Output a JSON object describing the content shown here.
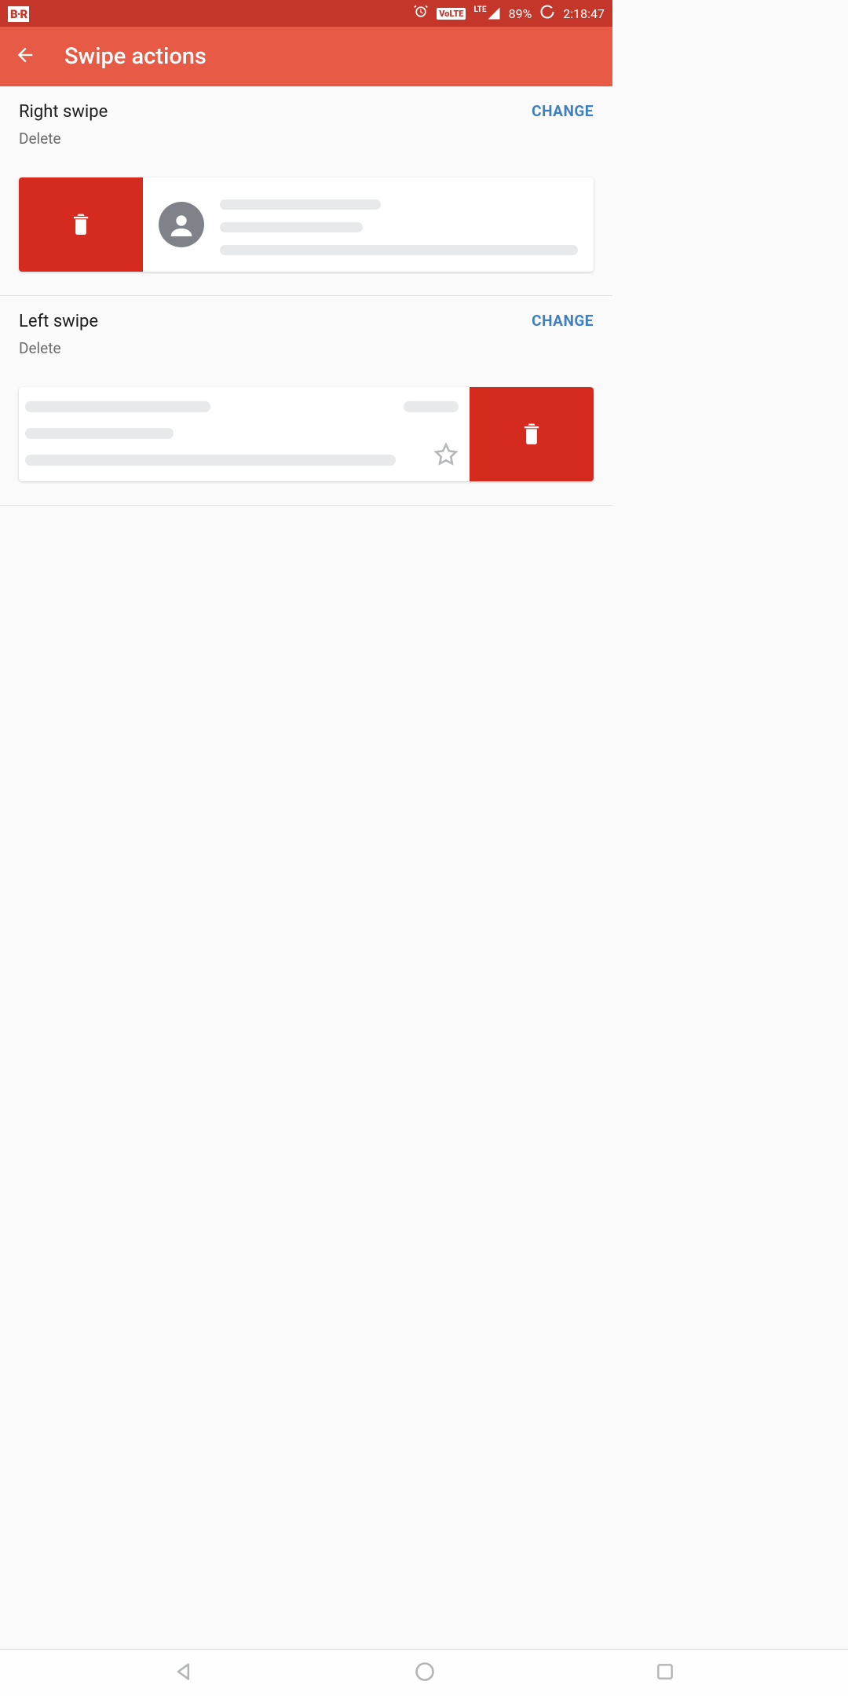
{
  "status": {
    "app_badge": "B·R",
    "volte": "VoLTE",
    "net_label": "LTE",
    "battery": "89%",
    "time": "2:18:47"
  },
  "appbar": {
    "title": "Swipe actions"
  },
  "sections": {
    "right": {
      "title": "Right swipe",
      "action": "Delete",
      "change": "CHANGE"
    },
    "left": {
      "title": "Left swipe",
      "action": "Delete",
      "change": "CHANGE"
    }
  }
}
